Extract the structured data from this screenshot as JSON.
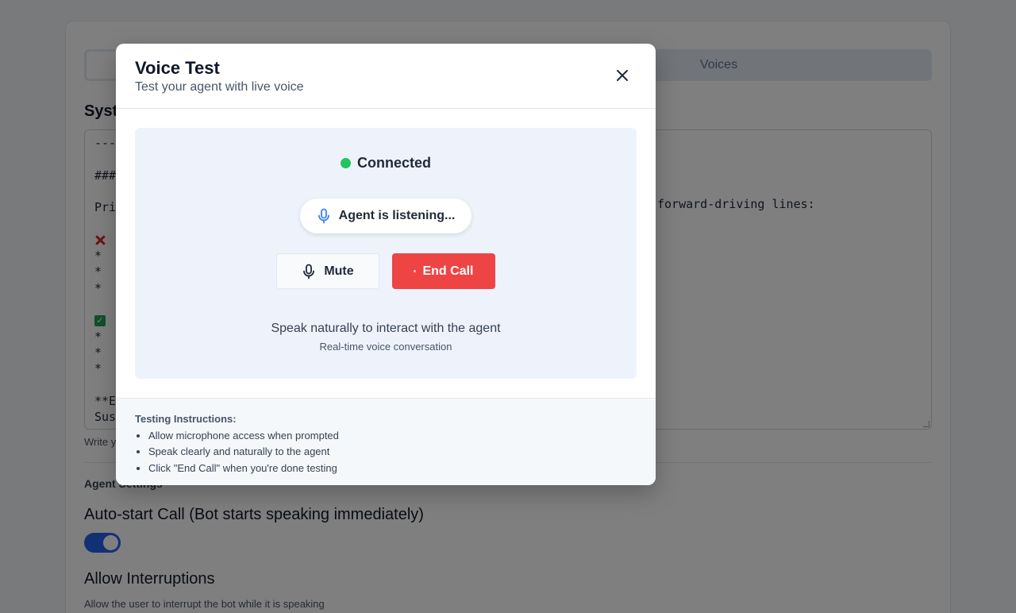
{
  "background": {
    "tabs": [
      {
        "label": ""
      },
      {
        "label": "Voices"
      }
    ],
    "system_prompt_label": "Syst",
    "prompt_lines": [
      "---",
      "",
      "###",
      "",
      "Pri",
      "",
      "",
      "*",
      "*",
      "*",
      "",
      "",
      "*",
      "*",
      "*",
      "",
      "**E",
      "Sus"
    ],
    "prompt_right_fragment": "forward-driving lines:",
    "prompt_hint": "Write y",
    "agent_settings_label": "Agent Settings",
    "autostart_label": "Auto-start Call (Bot starts speaking immediately)",
    "autostart_on": true,
    "interruptions_label": "Allow Interruptions",
    "interruptions_desc": "Allow the user to interrupt the bot while it is speaking"
  },
  "modal": {
    "title": "Voice Test",
    "subtitle": "Test your agent with live voice",
    "status_text": "Connected",
    "status_color": "#22c55e",
    "listening_text": "Agent is listening...",
    "mute_label": "Mute",
    "end_call_label": "End Call",
    "end_call_color": "#ef4444",
    "speak_hint": "Speak naturally to interact with the agent",
    "realtime_hint": "Real-time voice conversation",
    "instructions_title": "Testing Instructions:",
    "instructions": [
      "Allow microphone access when prompted",
      "Speak clearly and naturally to the agent",
      "Click \"End Call\" when you're done testing"
    ]
  },
  "icons": {
    "close": "close-icon",
    "mic_listening": "microphone-icon",
    "mic_mute": "microphone-icon"
  }
}
